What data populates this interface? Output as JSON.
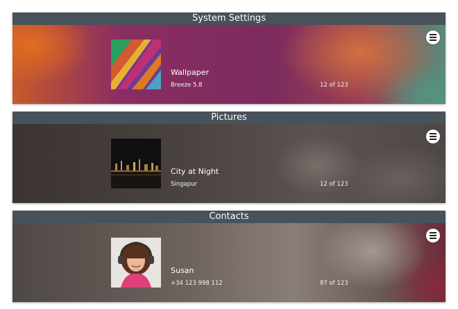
{
  "panels": [
    {
      "header": "System Settings",
      "title": "Wallpaper",
      "subtitle": "Breeze 5.8",
      "counter": "12 of 123"
    },
    {
      "header": "Pictures",
      "title": "City at Night",
      "subtitle": "Singapur",
      "counter": "12 of 123"
    },
    {
      "header": "Contacts",
      "title": "Susan",
      "subtitle": "+34 123 998 112",
      "counter": "87 of 123"
    }
  ],
  "colors": {
    "header_bg": "#47525a",
    "panel1_accent": "#8a2d62",
    "panel2_bg": "#4a4340",
    "panel3_bg": "#6d625d"
  }
}
